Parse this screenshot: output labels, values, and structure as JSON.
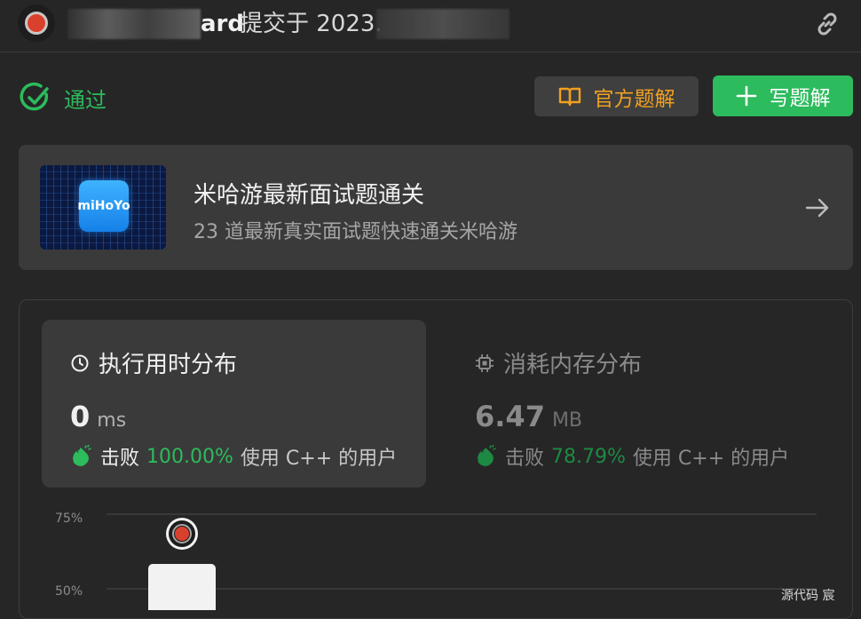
{
  "header": {
    "user_visible_suffix": "ard",
    "submitted_text": "提交于 2023."
  },
  "status": {
    "label": "通过",
    "color": "#2cbb5d"
  },
  "buttons": {
    "official_solution": "官方题解",
    "write_solution": "写题解"
  },
  "promo": {
    "logo_text": "miHoYo",
    "title": "米哈游最新面试题通关",
    "subtitle": "23 道最新真实面试题快速通关米哈游"
  },
  "runtime": {
    "title": "执行用时分布",
    "value": "0",
    "unit": "ms",
    "beat_label": "击败",
    "percent": "100.00%",
    "users_text": "使用 C++ 的用户"
  },
  "memory": {
    "title": "消耗内存分布",
    "value": "6.47",
    "unit": "MB",
    "beat_label": "击败",
    "percent": "78.79%",
    "users_text": "使用 C++ 的用户"
  },
  "chart_data": {
    "type": "bar",
    "y_ticks": [
      "75%",
      "50%"
    ],
    "grid": true
  },
  "footer": {
    "text": "源代码 宸"
  },
  "colors": {
    "accent_green": "#2cbb5d",
    "accent_orange": "#f0a020",
    "background": "#262626"
  }
}
